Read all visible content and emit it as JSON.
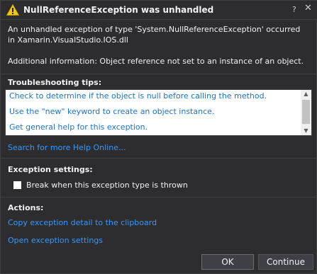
{
  "dialog": {
    "title": "NullReferenceException was unhandled",
    "message": "An unhandled exception of type 'System.NullReferenceException' occurred in Xamarin.VisualStudio.IOS.dll",
    "additional_info": "Additional information: Object reference not set to an instance of an object."
  },
  "troubleshooting": {
    "title": "Troubleshooting tips:",
    "tips": [
      "Check to determine if the object is null before calling the method.",
      "Use the \"new\" keyword to create an object instance.",
      "Get general help for this exception."
    ],
    "search_link": "Search for more Help Online..."
  },
  "exception_settings": {
    "title": "Exception settings:",
    "checkbox_label": "Break when this exception type is thrown",
    "checked": false
  },
  "actions": {
    "title": "Actions:",
    "copy_link": "Copy exception detail to the clipboard",
    "open_link": "Open exception settings"
  },
  "buttons": {
    "ok": "OK",
    "continue": "Continue"
  },
  "icons": {
    "warning": "warning-icon",
    "help": "help-icon",
    "close": "close-icon"
  },
  "colors": {
    "background": "#2d2d30",
    "link": "#3399ff",
    "tip_link": "#1a73c9",
    "warning": "#f2c811"
  }
}
